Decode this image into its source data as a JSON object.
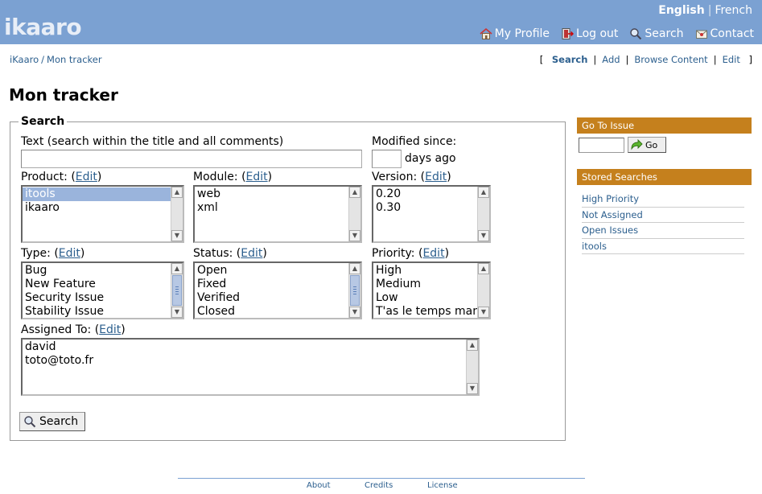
{
  "header": {
    "logo": "ikaaro",
    "languages": {
      "active": "English",
      "separator": "|",
      "other": "French"
    },
    "nav": [
      {
        "label": "My Profile",
        "icon": "home-icon"
      },
      {
        "label": "Log out",
        "icon": "logout-icon"
      },
      {
        "label": "Search",
        "icon": "search-icon"
      },
      {
        "label": "Contact",
        "icon": "contact-icon"
      }
    ]
  },
  "breadcrumb": {
    "root": "iKaaro",
    "separator": "/",
    "current": "Mon tracker"
  },
  "actions": {
    "open": "[",
    "close": "]",
    "sep": "|",
    "items": [
      "Search",
      "Add",
      "Browse Content",
      "Edit"
    ]
  },
  "page_title": "Mon tracker",
  "search_form": {
    "legend": "Search",
    "text_label": "Text (search within the title and all comments)",
    "text_value": "",
    "modified_label": "Modified since:",
    "modified_value": "",
    "days_ago": "days ago",
    "edit_link": "Edit",
    "open_paren": "(",
    "close_paren": ")",
    "product": {
      "label": "Product:",
      "options": [
        "itools",
        "ikaaro"
      ],
      "selected": "itools"
    },
    "module": {
      "label": "Module:",
      "options": [
        "web",
        "xml"
      ]
    },
    "version": {
      "label": "Version:",
      "options": [
        "0.20",
        "0.30"
      ]
    },
    "type": {
      "label": "Type:",
      "options": [
        "Bug",
        "New Feature",
        "Security Issue",
        "Stability Issue"
      ]
    },
    "status": {
      "label": "Status:",
      "options": [
        "Open",
        "Fixed",
        "Verified",
        "Closed"
      ]
    },
    "priority": {
      "label": "Priority:",
      "options": [
        "High",
        "Medium",
        "Low",
        "T'as le temps man"
      ]
    },
    "assigned": {
      "label": "Assigned To:",
      "options": [
        "david",
        "toto@toto.fr"
      ]
    },
    "submit_label": "Search"
  },
  "sidebar": {
    "goto_title": "Go To Issue",
    "goto_value": "",
    "go_label": "Go",
    "stored_title": "Stored Searches",
    "stored": [
      "High Priority",
      "Not Assigned",
      "Open Issues",
      "itools"
    ]
  },
  "footer": {
    "links": [
      "About",
      "Credits",
      "License"
    ]
  },
  "colors": {
    "header": "#7ba1d2",
    "sidebar_title": "#c5801d",
    "link": "#2c5f8e",
    "selected": "#9ab4dc"
  }
}
